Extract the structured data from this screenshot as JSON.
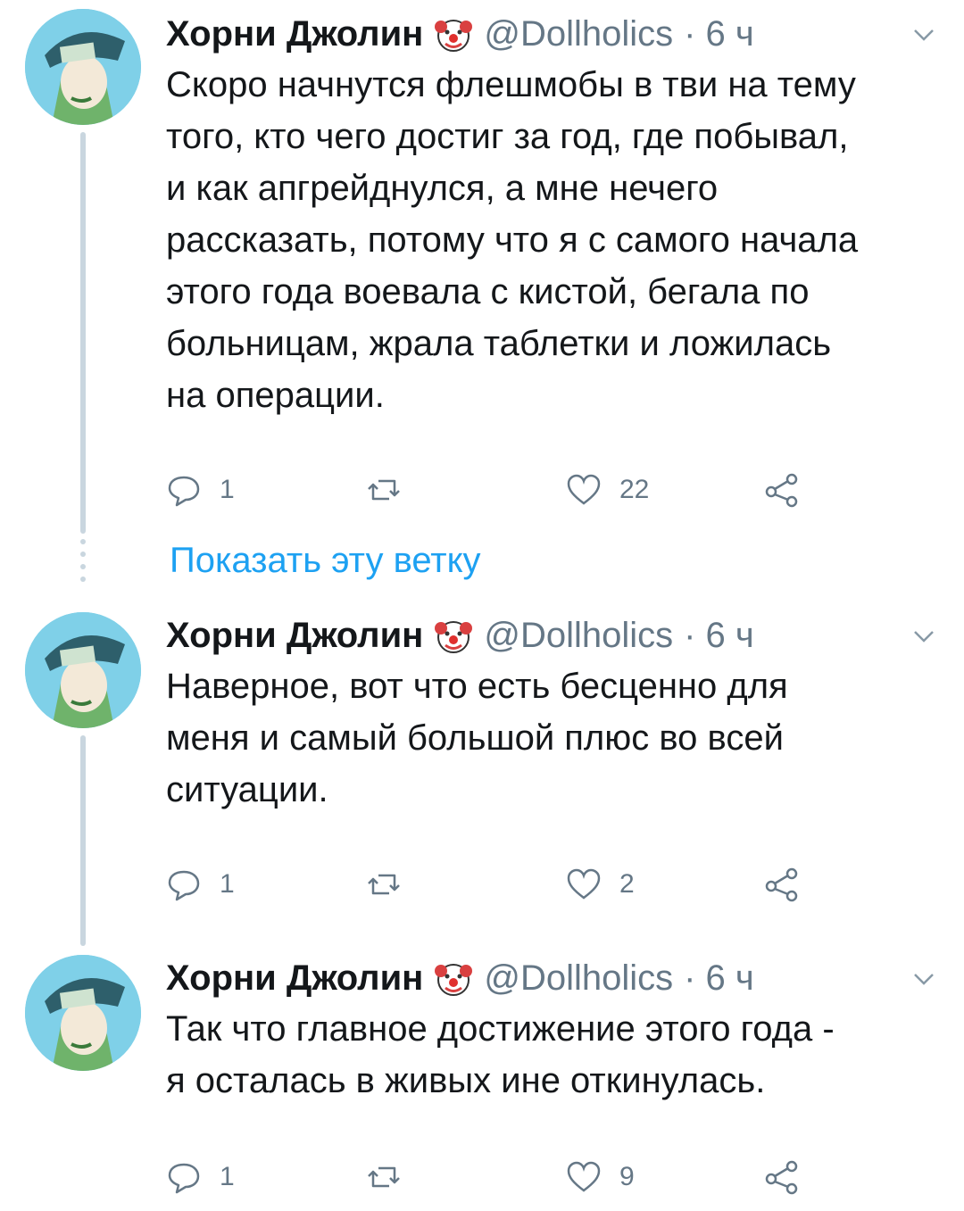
{
  "tweets": [
    {
      "name": "Хорни Джолин",
      "emoji_icon": "clown-face-emoji",
      "handle": "@Dollholics",
      "time": "· 6 ч",
      "text": "Скоро начнутся флешмобы в тви на тему\nтого, кто чего достиг за год, где побывал,\nи как апгрейднулся, а мне нечего\nрассказать, потому что я с самого начала\nэтого года воевала с кистой, бегала по\nбольницам, жрала таблетки и ложилась\nна операции.",
      "replies": "1",
      "retweets": "",
      "likes": "22"
    },
    {
      "name": "Хорни Джолин",
      "emoji_icon": "clown-face-emoji",
      "handle": "@Dollholics",
      "time": "· 6 ч",
      "text": "Наверное, вот что есть бесценно для\nменя и самый большой плюс во всей\nситуации.",
      "replies": "1",
      "retweets": "",
      "likes": "2"
    },
    {
      "name": "Хорни Джолин",
      "emoji_icon": "clown-face-emoji",
      "handle": "@Dollholics",
      "time": "· 6 ч",
      "text": "Так что главное достижение этого года -\nя осталась в живых ине откинулась.",
      "replies": "1",
      "retweets": "",
      "likes": "9"
    }
  ],
  "show_thread": "Показать эту ветку",
  "colors": {
    "accent": "#1da1f2",
    "secondary_text": "#657786",
    "thread_line": "#c9d6df"
  },
  "icons": [
    "reply-icon",
    "retweet-icon",
    "like-icon",
    "share-icon",
    "chevron-down-icon"
  ]
}
